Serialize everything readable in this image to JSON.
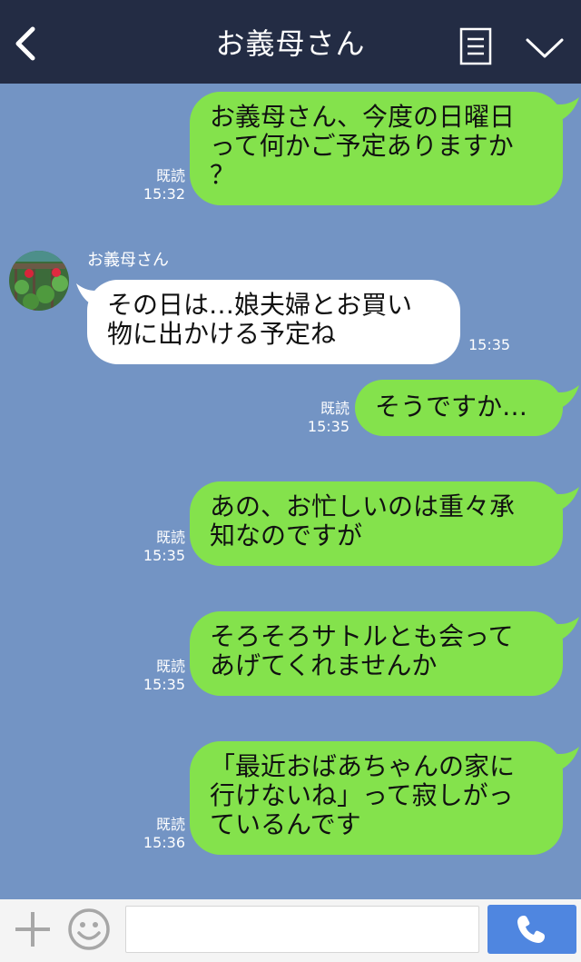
{
  "header": {
    "title": "お義母さん",
    "back_icon": "chevron-left-icon",
    "menu_icon": "list-icon",
    "toggle_icon": "chevron-down-icon"
  },
  "colors": {
    "header_bg": "#232c44",
    "chat_bg": "#7394c4",
    "outgoing_bubble": "#84e24c",
    "incoming_bubble": "#ffffff",
    "call_button": "#4f86e0"
  },
  "messages": [
    {
      "direction": "out",
      "text": "お義母さん、今度の日曜日\nって何かご予定ありますか\n？",
      "read": "既読",
      "time": "15:32"
    },
    {
      "direction": "in",
      "sender": "お義母さん",
      "text": "その日は…娘夫婦とお買い\n物に出かける予定ね",
      "time": "15:35"
    },
    {
      "direction": "out",
      "text": "そうですか…",
      "read": "既読",
      "time": "15:35"
    },
    {
      "direction": "out",
      "text": "あの、お忙しいのは重々承\n知なのですが",
      "read": "既読",
      "time": "15:35"
    },
    {
      "direction": "out",
      "text": "そろそろサトルとも会って\nあげてくれませんか",
      "read": "既読",
      "time": "15:35"
    },
    {
      "direction": "out",
      "text": "「最近おばあちゃんの家に\n行けないね」って寂しがっ\nているんです",
      "read": "既読",
      "time": "15:36"
    }
  ],
  "input_bar": {
    "message_value": "",
    "plus_icon": "plus-icon",
    "emoji_icon": "smiley-icon",
    "call_icon": "phone-icon"
  }
}
